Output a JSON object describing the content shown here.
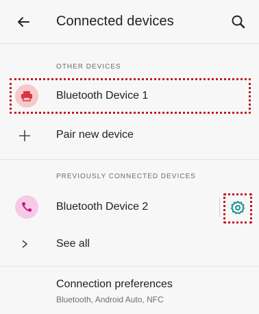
{
  "header": {
    "title": "Connected devices",
    "back_icon": "arrow-left-icon",
    "search_icon": "search-icon"
  },
  "sections": {
    "other_devices": "OTHER DEVICES",
    "previously_connected": "PREVIOUSLY CONNECTED DEVICES"
  },
  "rows": {
    "device1": {
      "label": "Bluetooth Device 1",
      "icon": "printer-icon"
    },
    "pair": {
      "label": "Pair new device",
      "icon": "plus-icon"
    },
    "device2": {
      "label": "Bluetooth Device 2",
      "icon": "phone-icon",
      "action_icon": "gear-icon"
    },
    "see_all": {
      "label": "See all",
      "icon": "chevron-right-icon"
    }
  },
  "preferences": {
    "title": "Connection preferences",
    "subtitle": "Bluetooth, Android Auto, NFC"
  },
  "colors": {
    "printer_bg": "#f6c9cb",
    "printer_fg": "#d9363e",
    "phone_bg": "#f6c9e6",
    "phone_fg": "#c2187a",
    "gear": "#1a8f8f",
    "highlight": "#c4161c"
  }
}
